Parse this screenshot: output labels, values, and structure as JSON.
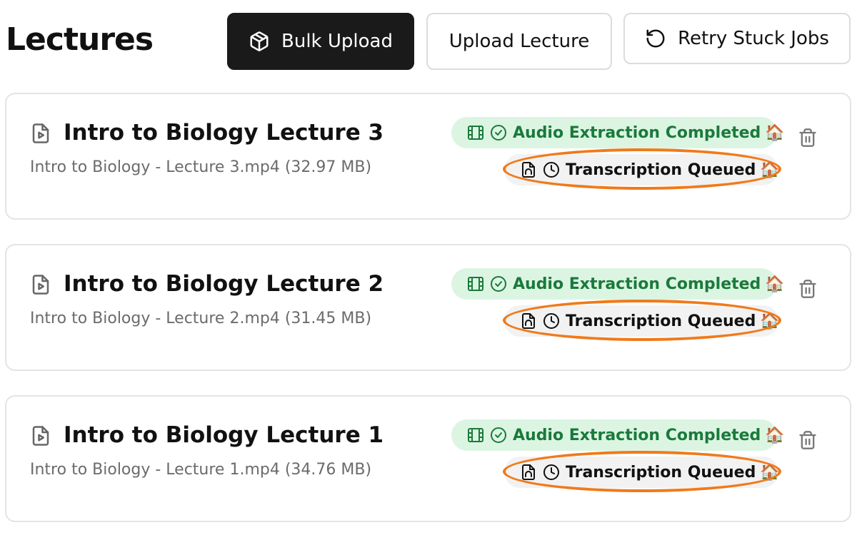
{
  "header": {
    "title": "Lectures",
    "bulk_upload_label": "Bulk Upload",
    "upload_lecture_label": "Upload Lecture",
    "retry_label": "Retry Stuck Jobs"
  },
  "lectures": [
    {
      "title": "Intro to Biology Lecture 3",
      "file": "Intro to Biology - Lecture 3.mp4 (32.97 MB)",
      "audio_status": "Audio Extraction Completed",
      "transcription_status": "Transcription Queued",
      "status_emoji": "🏠"
    },
    {
      "title": "Intro to Biology Lecture 2",
      "file": "Intro to Biology - Lecture 2.mp4 (31.45 MB)",
      "audio_status": "Audio Extraction Completed",
      "transcription_status": "Transcription Queued",
      "status_emoji": "🏠"
    },
    {
      "title": "Intro to Biology Lecture 1",
      "file": "Intro to Biology - Lecture 1.mp4 (34.76 MB)",
      "audio_status": "Audio Extraction Completed",
      "transcription_status": "Transcription Queued",
      "status_emoji": "🏠"
    }
  ],
  "icons": {
    "bulk_upload": "package-icon",
    "retry": "rotate-ccw-icon",
    "file": "file-video-icon",
    "audio": "film-icon",
    "check": "check-circle-icon",
    "audio_file": "file-audio-icon",
    "clock": "clock-icon",
    "delete": "trash-icon"
  },
  "colors": {
    "primary_button": "#1a1a1a",
    "success_bg": "#dcf5e3",
    "success_text": "#1a7a3a",
    "neutral_badge_bg": "#f2f2f2",
    "highlight": "#f07a1a"
  }
}
